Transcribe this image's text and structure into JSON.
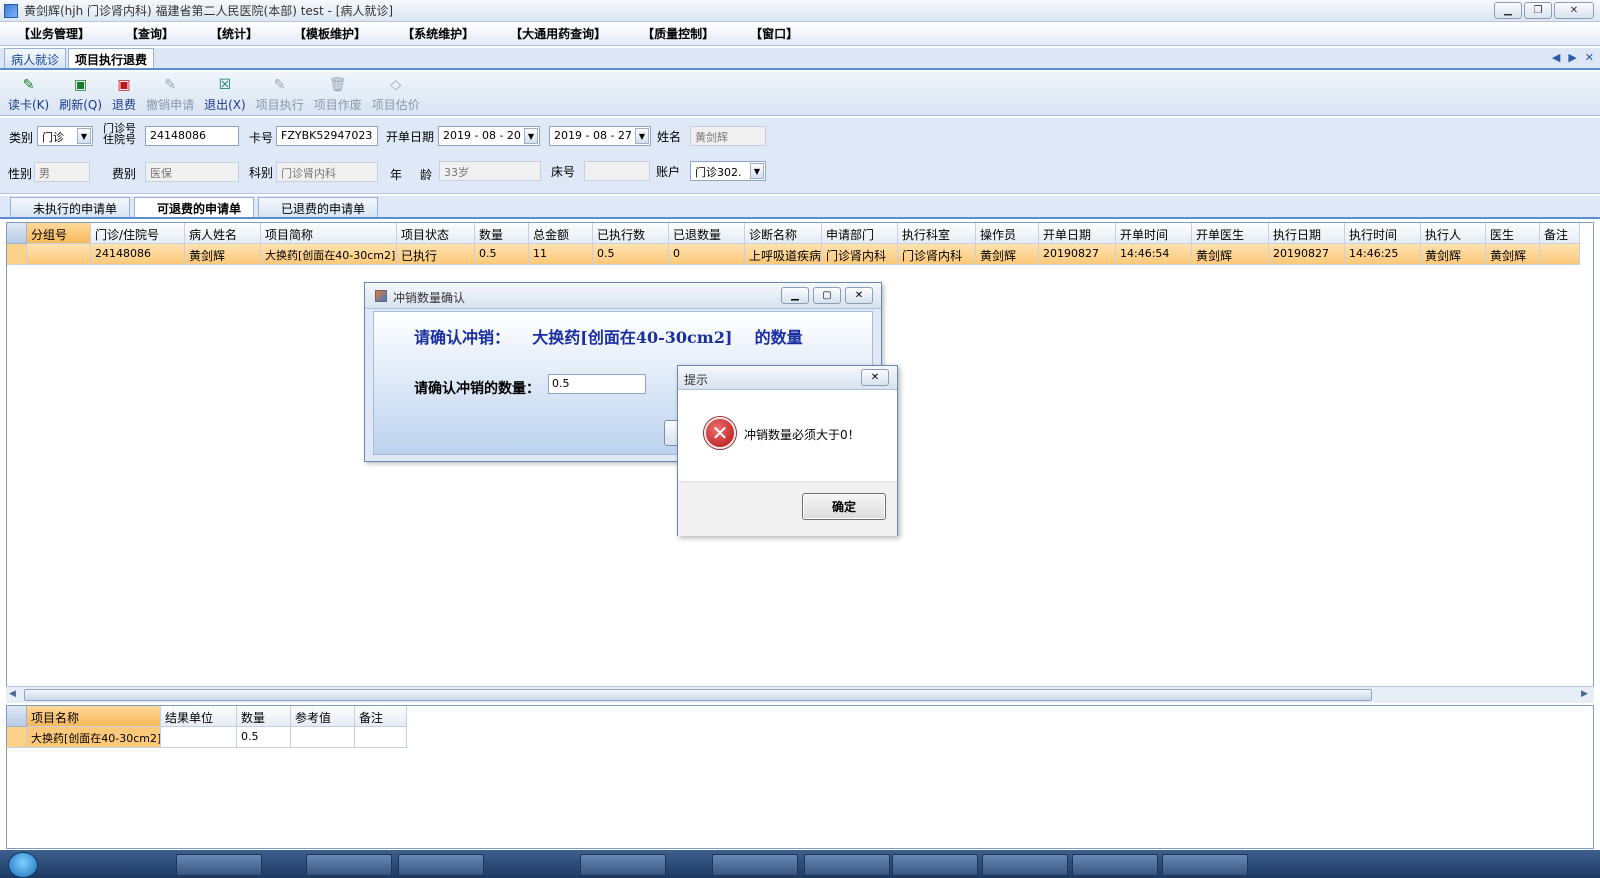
{
  "window": {
    "title": "黄剑辉(hjh 门诊肾内科) 福建省第二人民医院(本部) test - [病人就诊]"
  },
  "menu": [
    "【业务管理】",
    "【查询】",
    "【统计】",
    "【模板维护】",
    "【系统维护】",
    "【大通用药查询】",
    "【质量控制】",
    "【窗口】"
  ],
  "doc_tabs": [
    "病人就诊",
    "项目执行退费"
  ],
  "toolbar": [
    {
      "label": "读卡(K)",
      "icon": "card-reader-icon",
      "enabled": true
    },
    {
      "label": "刷新(Q)",
      "icon": "refresh-icon",
      "enabled": true
    },
    {
      "label": "退费",
      "icon": "refund-icon",
      "enabled": true
    },
    {
      "label": "撤销申请",
      "icon": "revoke-icon",
      "enabled": false
    },
    {
      "label": "退出(X)",
      "icon": "exit-icon",
      "enabled": true
    },
    {
      "label": "项目执行",
      "icon": "execute-icon",
      "enabled": false
    },
    {
      "label": "项目作废",
      "icon": "trash-icon",
      "enabled": false
    },
    {
      "label": "项目估价",
      "icon": "eraser-icon",
      "enabled": false
    }
  ],
  "form": {
    "category_label": "类别",
    "category_value": "门诊",
    "visit_no_label_line1": "门诊号",
    "visit_no_label_line2": "住院号",
    "visit_no_value": "24148086",
    "card_label": "卡号",
    "card_value": "FZYBK52947023",
    "open_date_label": "开单日期",
    "date_from": "2019 - 08 - 20",
    "date_to": "2019 - 08 - 27",
    "name_label": "姓名",
    "name_value": "黄剑辉",
    "gender_label": "性别",
    "gender_value": "男",
    "fee_type_label": "费别",
    "fee_type_value": "医保",
    "dept_label": "科别",
    "dept_value": "门诊肾内科",
    "age_label_1": "年",
    "age_label_2": "龄",
    "age_value": "33岁",
    "bed_label": "床号",
    "bed_value": "",
    "account_label": "账户",
    "account_value": "门诊302."
  },
  "sub_tabs": [
    "未执行的申请单",
    "可退费的申请单",
    "已退费的申请单"
  ],
  "main_grid": {
    "columns": [
      "分组号",
      "门诊/住院号",
      "病人姓名",
      "项目简称",
      "项目状态",
      "数量",
      "总金额",
      "已执行数",
      "已退数量",
      "诊断名称",
      "申请部门",
      "执行科室",
      "操作员",
      "开单日期",
      "开单时间",
      "开单医生",
      "执行日期",
      "执行时间",
      "执行人",
      "医生",
      "备注"
    ],
    "rows": [
      [
        "",
        "24148086",
        "黄剑辉",
        "大换药[创面在40-30cm2]",
        "已执行",
        "0.5",
        "11",
        "0.5",
        "0",
        "上呼吸道疾病",
        "门诊肾内科",
        "门诊肾内科",
        "黄剑辉",
        "20190827",
        "14:46:54",
        "黄剑辉",
        "20190827",
        "14:46:25",
        "黄剑辉",
        "黄剑辉",
        ""
      ]
    ]
  },
  "detail_grid": {
    "columns": [
      "项目名称",
      "结果单位",
      "数量",
      "参考值",
      "备注"
    ],
    "rows": [
      [
        "大换药[创面在40-30cm2]",
        "",
        "0.5",
        "",
        ""
      ]
    ]
  },
  "confirm_dialog": {
    "title": "冲销数量确认",
    "heading": "请确认冲销：    大换药[创面在40-30cm2]    的数量",
    "qty_label": "请确认冲销的数量：",
    "qty_value": "0.5"
  },
  "alert_dialog": {
    "title": "提示",
    "message": "冲销数量必须大于0！",
    "ok_label": "确定"
  }
}
